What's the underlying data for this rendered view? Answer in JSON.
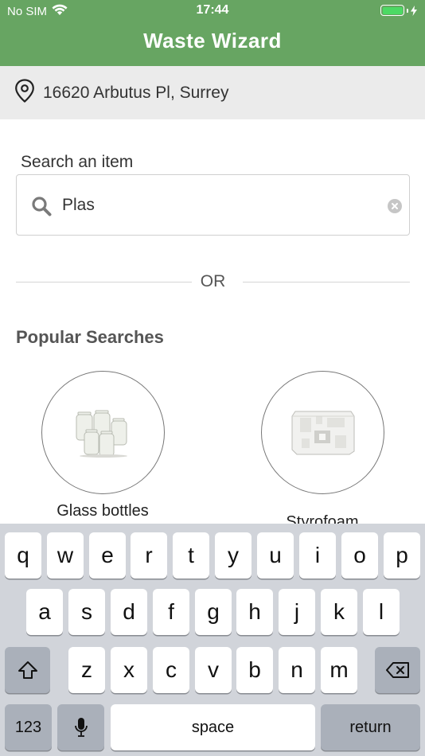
{
  "status_bar": {
    "carrier": "No SIM",
    "time": "17:44"
  },
  "header": {
    "title": "Waste Wizard"
  },
  "location": {
    "address": "16620 Arbutus Pl, Surrey"
  },
  "search": {
    "label": "Search an item",
    "value": "Plas"
  },
  "divider": {
    "text": "OR"
  },
  "popular": {
    "title": "Popular Searches",
    "items": [
      {
        "label": "Glass bottles"
      },
      {
        "label": "Styrofoam"
      }
    ]
  },
  "keyboard": {
    "row1": [
      "q",
      "w",
      "e",
      "r",
      "t",
      "y",
      "u",
      "i",
      "o",
      "p"
    ],
    "row2": [
      "a",
      "s",
      "d",
      "f",
      "g",
      "h",
      "j",
      "k",
      "l"
    ],
    "row3": [
      "z",
      "x",
      "c",
      "v",
      "b",
      "n",
      "m"
    ],
    "numbers_key": "123",
    "space_key": "space",
    "return_key": "return"
  },
  "colors": {
    "header_bg": "#67a562",
    "address_bg": "#ebebeb",
    "keyboard_bg": "#d1d4da"
  }
}
